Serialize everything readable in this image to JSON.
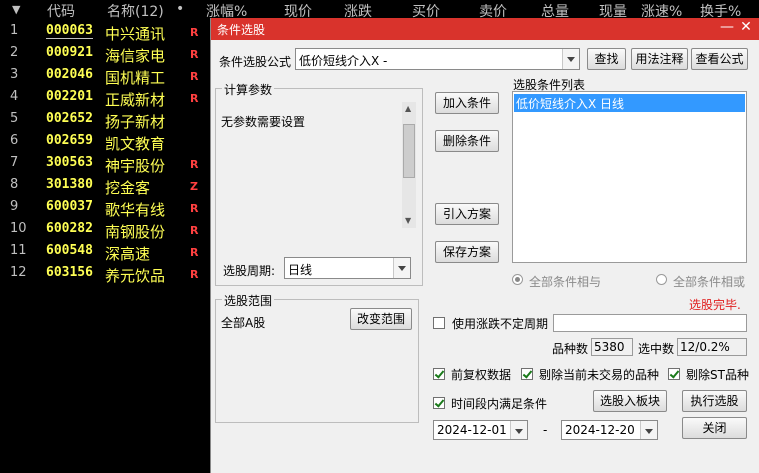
{
  "stock_list": {
    "headers": [
      "代码",
      "名称(12)",
      "•",
      "涨幅%",
      "现价",
      "涨跌",
      "买价",
      "卖价",
      "总量",
      "现量",
      "涨速%",
      "换手%"
    ],
    "rows": [
      {
        "idx": "1",
        "code": "000063",
        "name": "中兴通讯",
        "flag": "R"
      },
      {
        "idx": "2",
        "code": "000921",
        "name": "海信家电",
        "flag": "R"
      },
      {
        "idx": "3",
        "code": "002046",
        "name": "国机精工",
        "flag": "R"
      },
      {
        "idx": "4",
        "code": "002201",
        "name": "正威新材",
        "flag": "R"
      },
      {
        "idx": "5",
        "code": "002652",
        "name": "扬子新材",
        "flag": ""
      },
      {
        "idx": "6",
        "code": "002659",
        "name": "凯文教育",
        "flag": ""
      },
      {
        "idx": "7",
        "code": "300563",
        "name": "神宇股份",
        "flag": "R"
      },
      {
        "idx": "8",
        "code": "301380",
        "name": "挖金客",
        "flag": "Z"
      },
      {
        "idx": "9",
        "code": "600037",
        "name": "歌华有线",
        "flag": "R"
      },
      {
        "idx": "10",
        "code": "600282",
        "name": "南钢股份",
        "flag": "R"
      },
      {
        "idx": "11",
        "code": "600548",
        "name": "深高速",
        "flag": "R"
      },
      {
        "idx": "12",
        "code": "603156",
        "name": "养元饮品",
        "flag": "R"
      }
    ]
  },
  "dialog": {
    "title": "条件选股",
    "minimize": "—",
    "close": "✕",
    "formula_label": "条件选股公式",
    "formula_value": "低价短线介入X -",
    "find_btn": "查找",
    "usage_btn": "用法注释",
    "view_formula_btn": "查看公式",
    "params_title": "计算参数",
    "params_text": "无参数需要设置",
    "period_label": "选股周期:",
    "period_value": "日线",
    "add_cond_btn": "加入条件",
    "del_cond_btn": "删除条件",
    "import_btn": "引入方案",
    "save_btn": "保存方案",
    "cond_list_title": "选股条件列表",
    "cond_list_items": [
      "低价短线介入X  日线"
    ],
    "radio_and": "全部条件相与",
    "radio_or": "全部条件相或",
    "status": "选股完毕.",
    "range_title": "选股范围",
    "range_value": "全部A股",
    "change_range_btn": "改变范围",
    "use_variable_period": "使用涨跌不定周期",
    "count_label": "品种数",
    "count_value": "5380",
    "selected_label": "选中数",
    "selected_value": "12/0.2%",
    "fwd_adjust": "前复权数据",
    "exclude_untraded": "剔除当前未交易的品种",
    "exclude_st": "剔除ST品种",
    "period_satisfy": "时间段内满足条件",
    "to_block_btn": "选股入板块",
    "execute_btn": "执行选股",
    "start_date": "2024-12-01",
    "date_sep": "-",
    "end_date": "2024-12-20",
    "close_btn": "关闭"
  },
  "colors": {
    "titlebar": "#d9332c",
    "stock_code": "#ffff54",
    "flag": "#ff4040",
    "list_selected": "#3399ff"
  }
}
